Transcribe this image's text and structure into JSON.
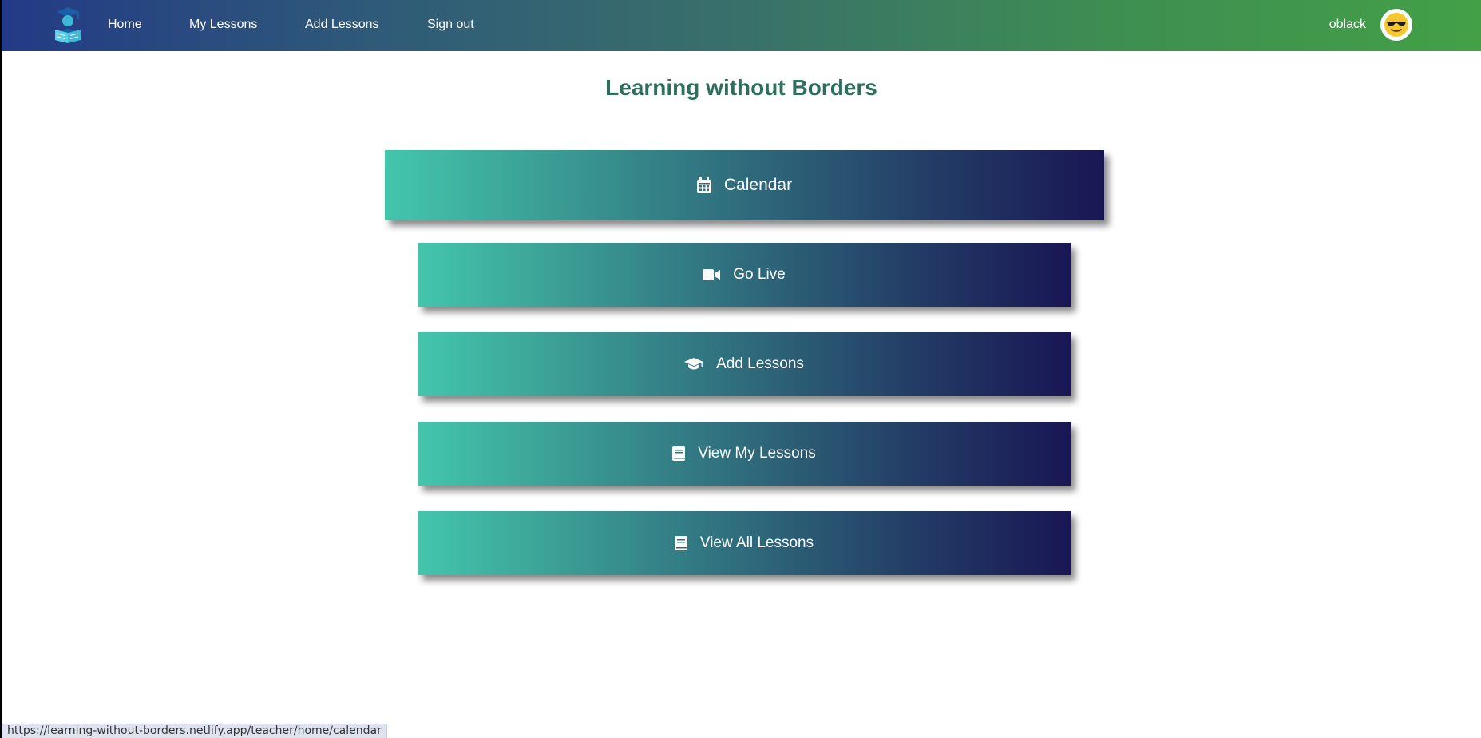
{
  "nav": {
    "links": [
      {
        "label": "Home"
      },
      {
        "label": "My Lessons"
      },
      {
        "label": "Add Lessons"
      },
      {
        "label": "Sign out"
      }
    ],
    "username": "oblack",
    "logo_icon": "graduate-reading-icon",
    "avatar_icon": "sunglasses-emoji-icon"
  },
  "page": {
    "title": "Learning without Borders"
  },
  "tiles": [
    {
      "label": "Calendar",
      "icon": "calendar-icon"
    },
    {
      "label": "Go Live",
      "icon": "video-camera-icon"
    },
    {
      "label": "Add Lessons",
      "icon": "graduation-cap-icon"
    },
    {
      "label": "View My Lessons",
      "icon": "book-icon"
    },
    {
      "label": "View All Lessons",
      "icon": "book-icon"
    }
  ],
  "status_bar": {
    "url": "https://learning-without-borders.netlify.app/teacher/home/calendar"
  },
  "colors": {
    "nav_gradient_start": "#233a86",
    "nav_gradient_end": "#43a047",
    "tile_gradient_start": "#43c6ac",
    "tile_gradient_end": "#191654",
    "title_color": "#2e6e5e"
  }
}
